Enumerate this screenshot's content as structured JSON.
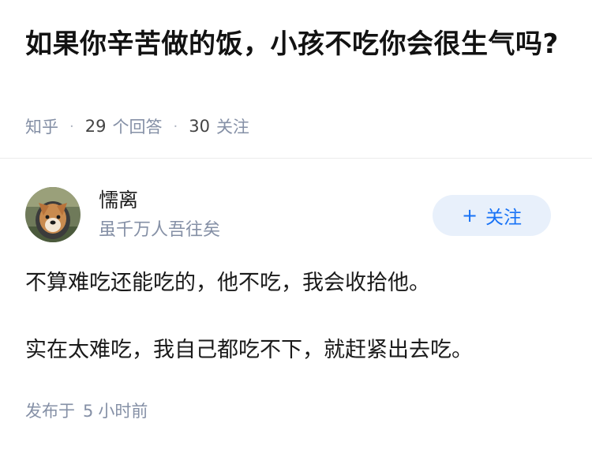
{
  "question": {
    "title": "如果你辛苦做的饭，小孩不吃你会很生气吗?",
    "source": "知乎",
    "answer_count": "29",
    "answer_label": "个回答",
    "follower_count": "30",
    "follower_label": "关注"
  },
  "answer": {
    "author": {
      "name": "懦离",
      "bio": "虽千万人吾往矣",
      "avatar_icon": "dog-avatar"
    },
    "follow_button": {
      "icon": "+",
      "label": "关注"
    },
    "paragraphs": [
      "不算难吃还能吃的，他不吃，我会收拾他。",
      "实在太难吃，我自己都吃不下，就赶紧出去吃。"
    ],
    "publish": {
      "prefix": "发布于",
      "value": "5",
      "unit": "小时前"
    }
  },
  "colors": {
    "accent": "#1772f6",
    "follow_bg": "#e8f0fb",
    "meta_text": "#8590a6"
  }
}
